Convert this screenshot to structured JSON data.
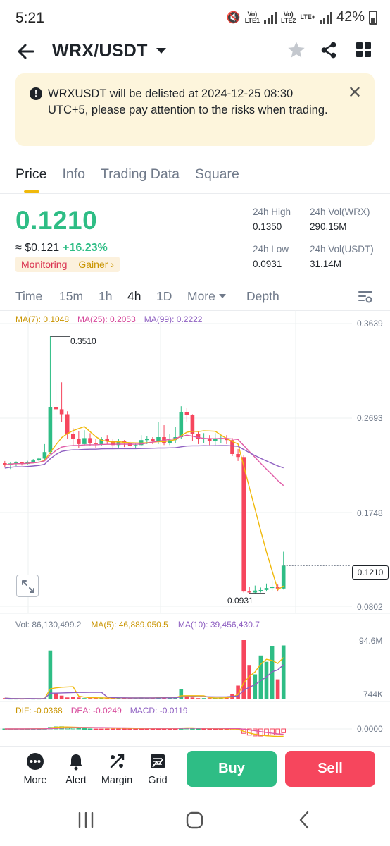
{
  "status_bar": {
    "time": "5:21",
    "battery": "42%",
    "net1": "LTE1",
    "net2": "LTE2",
    "net3": "LTE+"
  },
  "header": {
    "pair": "WRX/USDT"
  },
  "notice": {
    "text": "WRXUSDT will be delisted at 2024-12-25 08:30 UTC+5, please pay attention to the risks when trading.",
    "close": "✕"
  },
  "tabs": [
    "Price",
    "Info",
    "Trading Data",
    "Square"
  ],
  "price": {
    "last": "0.1210",
    "usd": "≈ $0.121",
    "change": "+16.23%",
    "tag_monitoring": "Monitoring",
    "tag_gainer": "Gainer ›",
    "high_label": "24h High",
    "high": "0.1350",
    "low_label": "24h Low",
    "low": "0.0931",
    "vol_base_label": "24h Vol(WRX)",
    "vol_base": "290.15M",
    "vol_quote_label": "24h Vol(USDT)",
    "vol_quote": "31.14M"
  },
  "timeframes": {
    "items": [
      "Time",
      "15m",
      "1h",
      "4h",
      "1D",
      "More",
      "Depth"
    ],
    "active": "4h"
  },
  "chart_data": {
    "type": "candlestick",
    "interval": "4h",
    "ma_legend": {
      "ma7": "MA(7): 0.1048",
      "ma25": "MA(25): 0.2053",
      "ma99": "MA(99): 0.2222"
    },
    "y_axis_ticks": [
      "0.3639",
      "0.2693",
      "0.1748",
      "0.0802"
    ],
    "y_axis_values": [
      0.3639,
      0.2693,
      0.1748,
      0.0802
    ],
    "high_annotation": "0.3510",
    "low_annotation": "0.0931",
    "last_price_tag": "0.1210",
    "colors": {
      "up": "#2ebd85",
      "down": "#f6465d",
      "ma7": "#f0b90b",
      "ma25": "#e05aa6",
      "ma99": "#8e5fc1"
    },
    "candles": [
      [
        0.2238,
        0.222,
        0.226,
        0.2195
      ],
      [
        0.222,
        0.2236,
        0.2248,
        0.218
      ],
      [
        0.2236,
        0.2245,
        0.2256,
        0.221
      ],
      [
        0.2245,
        0.223,
        0.2252,
        0.2215
      ],
      [
        0.223,
        0.2252,
        0.2262,
        0.2222
      ],
      [
        0.2252,
        0.2266,
        0.228,
        0.224
      ],
      [
        0.2266,
        0.2285,
        0.2296,
        0.2255
      ],
      [
        0.2285,
        0.235,
        0.243,
        0.227
      ],
      [
        0.235,
        0.28,
        0.351,
        0.233
      ],
      [
        0.28,
        0.278,
        0.305,
        0.265
      ],
      [
        0.278,
        0.273,
        0.305,
        0.265
      ],
      [
        0.273,
        0.253,
        0.276,
        0.248
      ],
      [
        0.253,
        0.248,
        0.259,
        0.242
      ],
      [
        0.248,
        0.243,
        0.256,
        0.239
      ],
      [
        0.243,
        0.249,
        0.257,
        0.241
      ],
      [
        0.249,
        0.244,
        0.254,
        0.241
      ],
      [
        0.244,
        0.243,
        0.248,
        0.239
      ],
      [
        0.243,
        0.248,
        0.25,
        0.241
      ],
      [
        0.248,
        0.246,
        0.252,
        0.243
      ],
      [
        0.246,
        0.242,
        0.248,
        0.239
      ],
      [
        0.242,
        0.246,
        0.248,
        0.2395
      ],
      [
        0.246,
        0.244,
        0.247,
        0.24
      ],
      [
        0.244,
        0.2415,
        0.2465,
        0.2395
      ],
      [
        0.2415,
        0.242,
        0.2435,
        0.239
      ],
      [
        0.242,
        0.247,
        0.252,
        0.241
      ],
      [
        0.247,
        0.248,
        0.251,
        0.243
      ],
      [
        0.248,
        0.246,
        0.25,
        0.243
      ],
      [
        0.246,
        0.25,
        0.265,
        0.243
      ],
      [
        0.25,
        0.244,
        0.262,
        0.242
      ],
      [
        0.244,
        0.247,
        0.253,
        0.242
      ],
      [
        0.247,
        0.25,
        0.26,
        0.244
      ],
      [
        0.25,
        0.275,
        0.281,
        0.248
      ],
      [
        0.275,
        0.272,
        0.279,
        0.265
      ],
      [
        0.272,
        0.253,
        0.273,
        0.246
      ],
      [
        0.253,
        0.248,
        0.256,
        0.243
      ],
      [
        0.248,
        0.249,
        0.254,
        0.244
      ],
      [
        0.249,
        0.246,
        0.252,
        0.242
      ],
      [
        0.246,
        0.248,
        0.254,
        0.242
      ],
      [
        0.248,
        0.249,
        0.252,
        0.244
      ],
      [
        0.249,
        0.247,
        0.252,
        0.243
      ],
      [
        0.247,
        0.233,
        0.249,
        0.231
      ],
      [
        0.233,
        0.23,
        0.238,
        0.226
      ],
      [
        0.23,
        0.095,
        0.232,
        0.094
      ],
      [
        0.095,
        0.094,
        0.1,
        0.0931
      ],
      [
        0.094,
        0.096,
        0.101,
        0.0935
      ],
      [
        0.096,
        0.0965,
        0.099,
        0.094
      ],
      [
        0.0965,
        0.0985,
        0.103,
        0.095
      ],
      [
        0.0985,
        0.1,
        0.106,
        0.096
      ],
      [
        0.1,
        0.098,
        0.102,
        0.095
      ],
      [
        0.098,
        0.121,
        0.135,
        0.097
      ]
    ],
    "volume_legend": {
      "vol": "Vol: 86,130,499.2",
      "ma5": "MA(5): 46,889,050.5",
      "ma10": "MA(10): 39,456,430.7"
    },
    "volume_ticks": [
      "94.6M",
      "744K"
    ],
    "volume_max": 94.6,
    "volumes": [
      2,
      1,
      1,
      1,
      2,
      1,
      1,
      2,
      78,
      10,
      6,
      3,
      4,
      3,
      2,
      2,
      2,
      3,
      2,
      2,
      3,
      2,
      2,
      2,
      3,
      2,
      2,
      4,
      3,
      2,
      3,
      16,
      5,
      3,
      2,
      2,
      2,
      2,
      3,
      4,
      8,
      22,
      94.6,
      55,
      40,
      70,
      60,
      85,
      32,
      86.1
    ],
    "macd_legend": {
      "dif": "DIF: -0.0368",
      "dea": "DEA: -0.0249",
      "macd": "MACD: -0.0119"
    },
    "macd_tick": "0.0000"
  },
  "bottom_bar": {
    "more": "More",
    "alert": "Alert",
    "margin": "Margin",
    "grid": "Grid",
    "buy": "Buy",
    "sell": "Sell"
  }
}
